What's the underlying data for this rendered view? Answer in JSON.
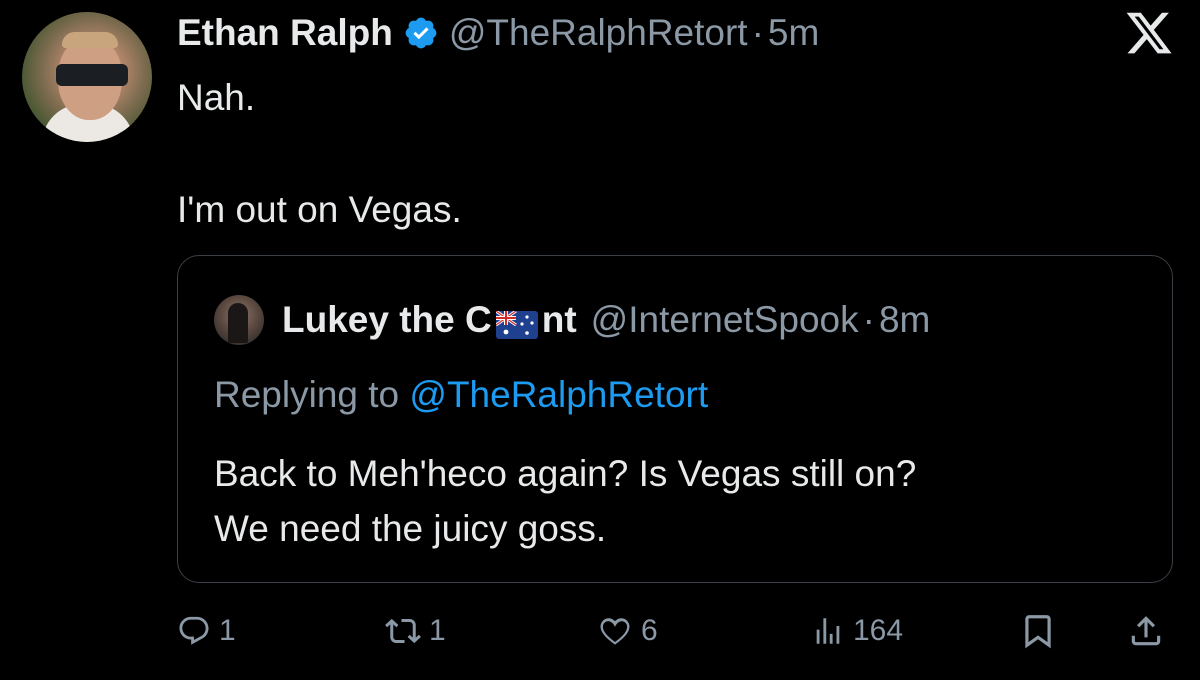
{
  "tweet": {
    "author_name": "Ethan Ralph",
    "handle": "@TheRalphRetort",
    "separator": "·",
    "time": "5m",
    "text_lines": [
      "Nah.",
      "I'm out on Vegas."
    ]
  },
  "quote": {
    "author_name_part1": "Lukey the C",
    "author_name_part2": "nt",
    "handle": "@InternetSpook",
    "separator": "·",
    "time": "8m",
    "replying_label": "Replying to",
    "replying_mention": "@TheRalphRetort",
    "text_lines": [
      "Back to Meh'heco again?  Is Vegas still on?",
      "We need the juicy goss."
    ]
  },
  "actions": {
    "reply_count": "1",
    "retweet_count": "1",
    "like_count": "6",
    "views_count": "164"
  },
  "colors": {
    "background": "#000000",
    "text": "#e7e9ea",
    "muted": "#8b98a5",
    "accent": "#1d9bf0",
    "border": "#3a3f45"
  },
  "icons": [
    "verified-badge-icon",
    "x-logo-icon",
    "australian-flag-icon",
    "reply-icon",
    "retweet-icon",
    "like-icon",
    "views-icon",
    "bookmark-icon",
    "share-icon"
  ]
}
